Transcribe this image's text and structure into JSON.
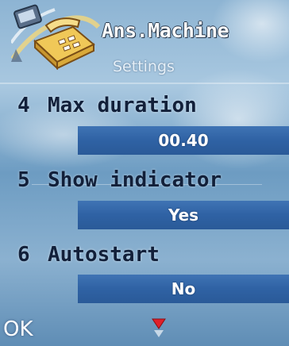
{
  "header": {
    "title": "Ans.Machine",
    "subtitle": "Settings",
    "icon": "answering-machine-icon"
  },
  "settings": [
    {
      "number": "4",
      "label": "Max duration",
      "value": "00.40"
    },
    {
      "number": "5",
      "label": "Show indicator",
      "value": "Yes"
    },
    {
      "number": "6",
      "label": "Autostart",
      "value": "No"
    }
  ],
  "softkeys": {
    "left": "OK"
  },
  "scroll_indicator": "scroll-down-icon",
  "colors": {
    "value_bar": "#3568a8",
    "label_text": "#12203a",
    "title_text": "#ffffff"
  }
}
